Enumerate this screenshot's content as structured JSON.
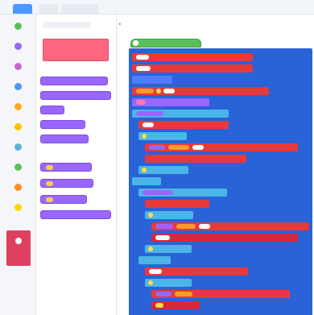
{
  "top_tabs": {
    "active_label": "",
    "second_label": "",
    "third_label": ""
  },
  "categories": [
    {
      "label": "",
      "color": "#59c059",
      "icon": "flag-icon"
    },
    {
      "label": "",
      "color": "#9966ff",
      "icon": "looks-icon"
    },
    {
      "label": "",
      "color": "#cf63cf",
      "icon": "sound-icon"
    },
    {
      "label": "",
      "color": "#4c97ff",
      "icon": "motion-icon"
    },
    {
      "label": "",
      "color": "#ffab19",
      "icon": "events-icon"
    },
    {
      "label": "",
      "color": "#ffbf00",
      "icon": "control-icon"
    },
    {
      "label": "",
      "color": "#5cb1d6",
      "icon": "sensing-icon"
    },
    {
      "label": "",
      "color": "#59c059",
      "icon": "operators-icon"
    },
    {
      "label": "",
      "color": "#ff8c1a",
      "icon": "variables-icon"
    },
    {
      "label": "",
      "color": "#ffd500",
      "icon": "lists-icon"
    }
  ],
  "selected_category": {
    "label": "",
    "color": "#e04060",
    "icon": "my-blocks-icon"
  },
  "palette": {
    "search_placeholder": "",
    "make_button_label": "",
    "heading_1": "",
    "heading_2": "",
    "blocks": [
      "",
      "",
      "",
      "",
      "",
      "",
      "",
      "",
      ""
    ]
  },
  "workspace": {
    "path": "",
    "hat_label": "",
    "rows": [
      "",
      "",
      "",
      "",
      "",
      "",
      "",
      "",
      "",
      "",
      "",
      "",
      "",
      "",
      "",
      "",
      "",
      "",
      "",
      "",
      "",
      "",
      "",
      "",
      "",
      "",
      "",
      "",
      "",
      "",
      ""
    ]
  },
  "colors": {
    "accent": "#4c97ff",
    "my_blocks": "#ff6680",
    "frame": "#2a62d8",
    "red_block": "#e63a3a",
    "cyan_block": "#4cb5e8",
    "violet_block": "#9966ff",
    "event_block": "#59c059"
  }
}
